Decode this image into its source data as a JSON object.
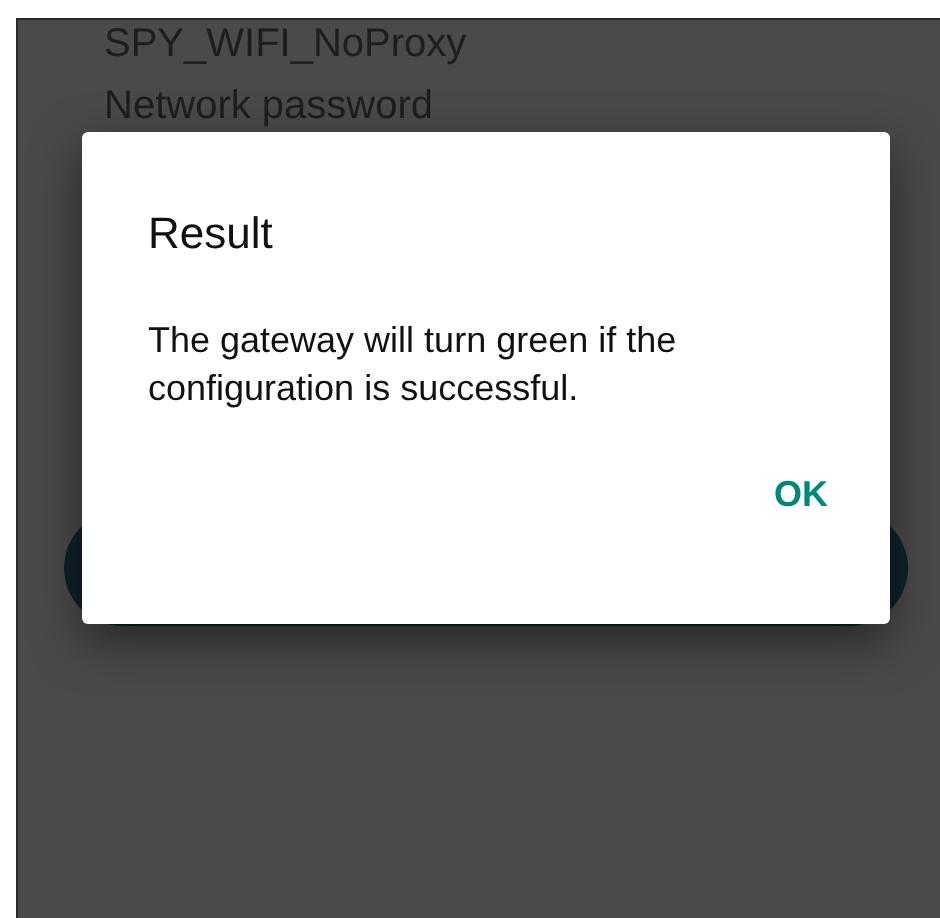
{
  "background": {
    "network_name": "SPY_WIFI_NoProxy",
    "password_label": "Network password"
  },
  "dialog": {
    "title": "Result",
    "message": "The gateway will turn green if the configuration is successful.",
    "buttons": [
      "OK"
    ]
  }
}
